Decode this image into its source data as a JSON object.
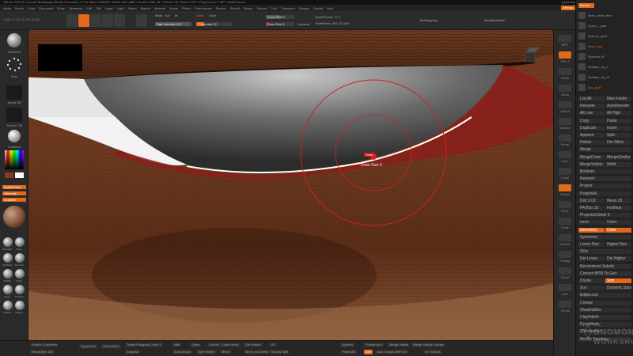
{
  "titlebar": {
    "text": "ZBrush 2021.5.6 [Lucas Bevilaqua]  ZBrush Document  ▪ Free Mem 19.88GB ▪ Active Mem 888 ▪ Scratch Disk 48 ▪ ZTime 9.82 Timer 0.012 ▪ PolyCount 9.1 MP ▪ MeshCount 1",
    "quicksave": "QuickSave",
    "seethrough": "See-through 0",
    "menus_label": "Menus",
    "default_script": "DefaultZScript"
  },
  "menubar": {
    "items": [
      "Alpha",
      "Brush",
      "Color",
      "Document",
      "Draw",
      "Dynamics",
      "Edit",
      "File",
      "Layer",
      "Light",
      "Macro",
      "Marker",
      "Material",
      "Movie",
      "Picker",
      "Preferences",
      "Render",
      "Stencil",
      "Stroke",
      "Texture",
      "Tool",
      "Transform",
      "Zplugin",
      "Zscript",
      "Help"
    ],
    "accent": "Menus"
  },
  "topbar": {
    "coords": "-0.25 -0.771 -0.175 -0.162",
    "mrgb": "Mrgb",
    "rgb": "Rgb",
    "m": "M",
    "zadd": "Zadd",
    "zsub": "Zsub",
    "rgb_intensity": "Rgb Intensity 100",
    "z_intensity": "Z Intensity 22",
    "focal_shift": "Focal Shift 0",
    "draw_size": "Draw Size 5",
    "dynamic": "Dynamic",
    "active_points": "ActivePoints: 77.0",
    "total_points": "TotalPoints: 308.221 Mil",
    "tool_label": "TestMapping",
    "backface": "BackfaceMask"
  },
  "leftshelf": {
    "standard": "Standard",
    "dots": "Dots",
    "alpha_off": "Alpha Off",
    "texture_off": "Texture Off",
    "gradient": "Gradient",
    "switch_color": "SwitchColor",
    "alternate": "Alternate",
    "brushes": [
      "Standard",
      "Move",
      "ClayBuild",
      "DamStd",
      "hPolish",
      "Inflate",
      "Pinch",
      "TrimDyn",
      "SnakeH",
      "Slash3"
    ]
  },
  "viewport": {
    "cursor_label": "Draw Size 5",
    "brush_tag": "Draw"
  },
  "rightshelf": {
    "labels": [
      "BPR",
      "SPix 3",
      "Scroll",
      "Zoom",
      "Actual",
      "AAHalf",
      "Persp",
      "Floor",
      "Local",
      "Frame",
      "Move",
      "Scale",
      "Rotate",
      "Transp",
      "Ghost",
      "Solo",
      "Xpose"
    ]
  },
  "rightpanel": {
    "subtools": [
      "Body_detail_final",
      "Eyes_L_gold",
      "Eyes_R_gold",
      "Brow_hair",
      "Eyebrow_R",
      "Eyelash_top_L",
      "Eyelash_top_R",
      "Eye_gold"
    ],
    "sections": {
      "list_all": "List All",
      "new_folder": "New Folder",
      "rename": "Rename",
      "autoreorder": "AutoReorder",
      "all_low": "All Low",
      "all_high": "All High",
      "copy": "Copy",
      "paste": "Paste",
      "duplicate": "Duplicate",
      "insert": "Insert",
      "append": "Append",
      "split": "Split",
      "delete": "Delete",
      "del_other": "Del Other",
      "merge": "Merge",
      "merge_down": "MergeDown",
      "merge_similar": "MergeSimilar",
      "merge_visible": "MergeVisible",
      "weld": "Weld",
      "boolean": "Boolean",
      "remesh": "Remesh",
      "project": "Project",
      "project_all": "ProjectAll",
      "dist": "Dist 0.02",
      "mean": "Mean 25",
      "pa_blur": "PA Blur 10",
      "farthest": "Farthest",
      "project_bp": "ProjectionShell 0",
      "inner": "Inner",
      "outer": "Outer",
      "geometry": "Geometry",
      "color": "Color",
      "symmetry": "Symmetry",
      "lower_res": "Lower Res",
      "higher_res": "Higher Res",
      "sdiv": "SDiv",
      "del_lower": "Del Lower",
      "del_higher": "Del Higher",
      "reconstruct": "Reconstruct Subdiv",
      "convert_bpr": "Convert BPR To Geo",
      "divide": "Divide",
      "smt": "Smt",
      "suv": "Suv",
      "dynamic_subdiv": "Dynamic Subdiv",
      "edge_loop": "EdgeLoop",
      "crease": "Crease",
      "shadow_box": "ShadowBox",
      "clay_polish": "ClayPolish",
      "dyna_mesh": "DynaMesh",
      "zremesher": "ZRemesher",
      "modify_topology": "Modify Topology"
    }
  },
  "bottombar": {
    "enable_customize": "Enable Customize",
    "resolution": "Resolution 128",
    "dyna_mesh": "DynaMesh",
    "zremesher": "ZRemesher",
    "target_polys": "Target Polygons Count 5",
    "adaptive": "Adaptive",
    "half": "Half",
    "same": "Same",
    "double": "Double",
    "auto_groups": "AutoGroups",
    "split_hidden": "Split Hidden",
    "group_split": "Groups Split",
    "close_holes": "Close Holes",
    "uv": "UV",
    "mirror": "Mirror",
    "mirror_weld": "Mirror And Weld",
    "del_hidden": "Del Hidden",
    "groups_split": "Groups Split",
    "append": "Append",
    "project_all": "ProjectAll",
    "poly_group_it": "Polygroup It",
    "merge_uv": "Merge Visible",
    "merge_similar": "Merge Similar Groups",
    "uv_groups": "UV Groups",
    "auto_groups_uv": "Auto Groups With UV",
    "zremesh_label": "ZRemesher Guide",
    "orange_label": "Edit"
  },
  "watermark": {
    "line1": "THE",
    "line2": "GNOMON",
    "line3": "WORKSHOP"
  }
}
